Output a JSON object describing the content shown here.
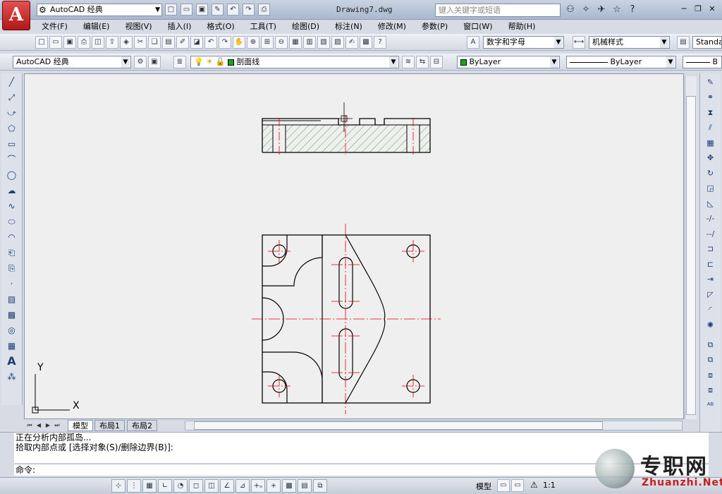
{
  "titlebar": {
    "app_logo": "A",
    "workspace": "AutoCAD 经典",
    "document_title": "Drawing7.dwg",
    "search_placeholder": "键入关键字或短语"
  },
  "menu": [
    "文件(F)",
    "编辑(E)",
    "视图(V)",
    "插入(I)",
    "格式(O)",
    "工具(T)",
    "绘图(D)",
    "标注(N)",
    "修改(M)",
    "参数(P)",
    "窗口(W)",
    "帮助(H)"
  ],
  "toolbar1": {
    "text_style": "数字和字母",
    "dim_style": "机械样式",
    "table_style": "Standa"
  },
  "toolbar2": {
    "workspace": "AutoCAD 经典",
    "layer": "剖面线",
    "color": "ByLayer",
    "linetype": "ByLayer",
    "lineweight": "B"
  },
  "tabs": [
    "模型",
    "布局1",
    "布局2"
  ],
  "ucs": {
    "x_label": "X",
    "y_label": "Y"
  },
  "command": {
    "line1": "正在分析内部孤岛...",
    "line2": "拾取内部点或 [选择对象(S)/删除边界(B)]:",
    "prompt": "命令:"
  },
  "status": {
    "model_label": "模型",
    "scale": "1:1"
  },
  "watermark": {
    "cn": "专职网",
    "url": "Zhuanzhi.Net"
  },
  "colors": {
    "drawing_line": "#000000",
    "center_line": "#e00000",
    "hatch": "#2e8b2e",
    "canvas_bg": "#efefef"
  }
}
